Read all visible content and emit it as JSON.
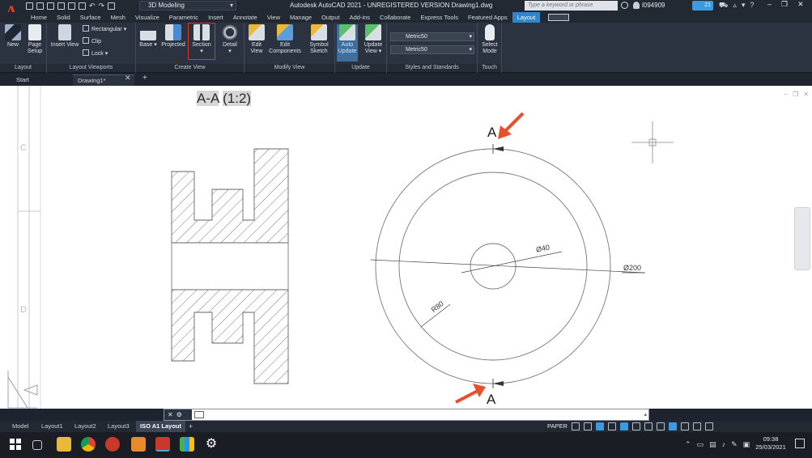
{
  "titlebar": {
    "workspace": "3D Modeling",
    "title": "Autodesk AutoCAD 2021 - UNREGISTERED VERSION    Drawing1.dwg",
    "search_placeholder": "Type a keyword or phrase",
    "user": "l094909",
    "notifications": "21",
    "app_letter": "A"
  },
  "ribbon_tabs": [
    "Home",
    "Solid",
    "Surface",
    "Mesh",
    "Visualize",
    "Parametric",
    "Insert",
    "Annotate",
    "View",
    "Manage",
    "Output",
    "Add-ins",
    "Collaborate",
    "Express Tools",
    "Featured Apps",
    "Layout"
  ],
  "ribbon": {
    "layout_panel": {
      "title": "Layout",
      "new": "New",
      "page_setup": [
        "Page",
        "Setup"
      ]
    },
    "viewports_panel": {
      "title": "Layout Viewports",
      "insert_view": "Insert View",
      "rectangular": "Rectangular",
      "clip": "Clip",
      "lock": "Lock"
    },
    "create_view_panel": {
      "title": "Create View",
      "base": "Base",
      "projected": "Projected",
      "section": "Section",
      "detail": "Detail"
    },
    "modify_view_panel": {
      "title": "Modify View",
      "edit_view": [
        "Edit",
        "View"
      ],
      "edit_components": [
        "Edit",
        "Components"
      ],
      "symbol_sketch": [
        "Symbol",
        "Sketch"
      ]
    },
    "update_panel": {
      "title": "Update",
      "auto_update": [
        "Auto",
        "Update"
      ],
      "update_view": [
        "Update",
        "View"
      ]
    },
    "styles_panel": {
      "title": "Styles and Standards",
      "style1": "Metric50",
      "style2": "Metric50"
    },
    "touch_panel": {
      "title": "Touch",
      "select_mode": [
        "Select",
        "Mode"
      ]
    }
  },
  "file_tabs": {
    "start": "Start",
    "drawing": "Drawing1*"
  },
  "drawing": {
    "section_label_prefix": "A-A",
    "section_label_scale": "(1:2)",
    "cut_letter_top": "A",
    "cut_letter_bottom": "A",
    "dim_inner": "Ø40",
    "dim_outer": "Ø200",
    "dim_radius": "R80"
  },
  "layout_tabs": [
    "Model",
    "Layout1",
    "Layout2",
    "Layout3",
    "ISO A1 Layout"
  ],
  "status": {
    "space": "PAPER"
  },
  "taskbar": {
    "time": "09:38",
    "date": "25/03/2021"
  }
}
